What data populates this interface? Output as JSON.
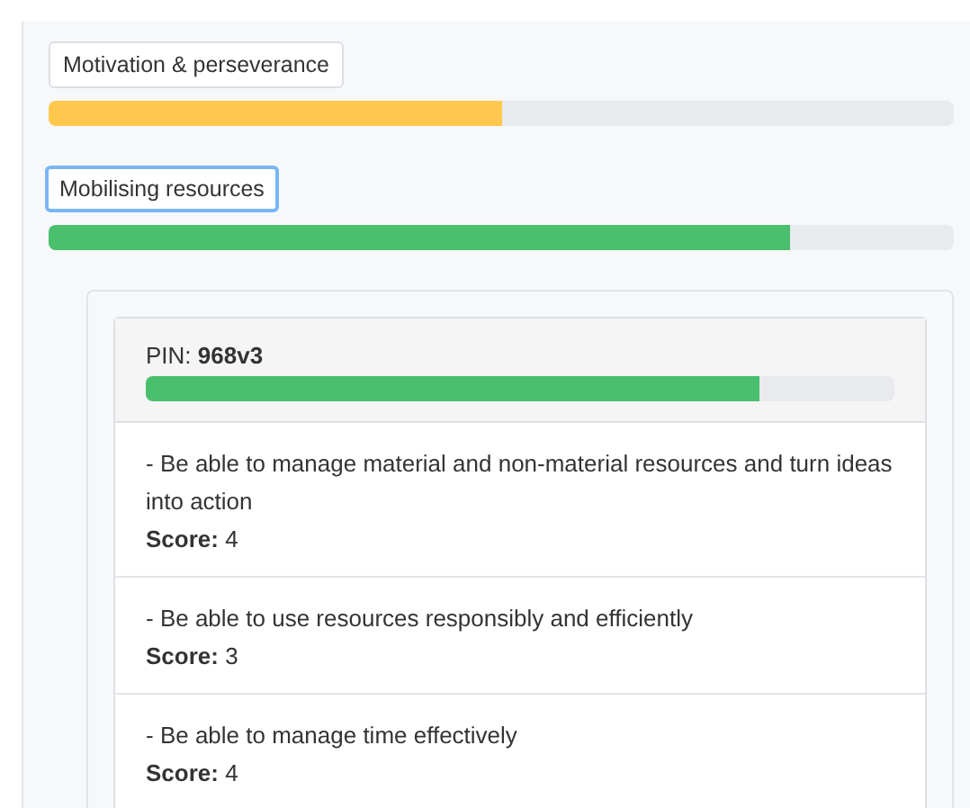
{
  "competences": [
    {
      "label": "Motivation & perseverance",
      "selected": false,
      "level": 0.5,
      "color": "#fec84f"
    },
    {
      "label": "Mobilising resources",
      "selected": true,
      "level": 0.82,
      "color": "#4abf6e"
    }
  ],
  "detail": {
    "pin": "PIN: **968v3**",
    "level": 0.82,
    "color": "#4abf6e",
    "items": [
      {
        "text": "- Be able to manage material and non-material resources and turn ideas into action",
        "score": "**Score:** 4"
      },
      {
        "text": "- Be able to use resources responsibly and efficiently",
        "score": "**Score:** 3"
      },
      {
        "text": "- Be able to manage time effectively",
        "score": "**Score:** 4"
      }
    ]
  }
}
